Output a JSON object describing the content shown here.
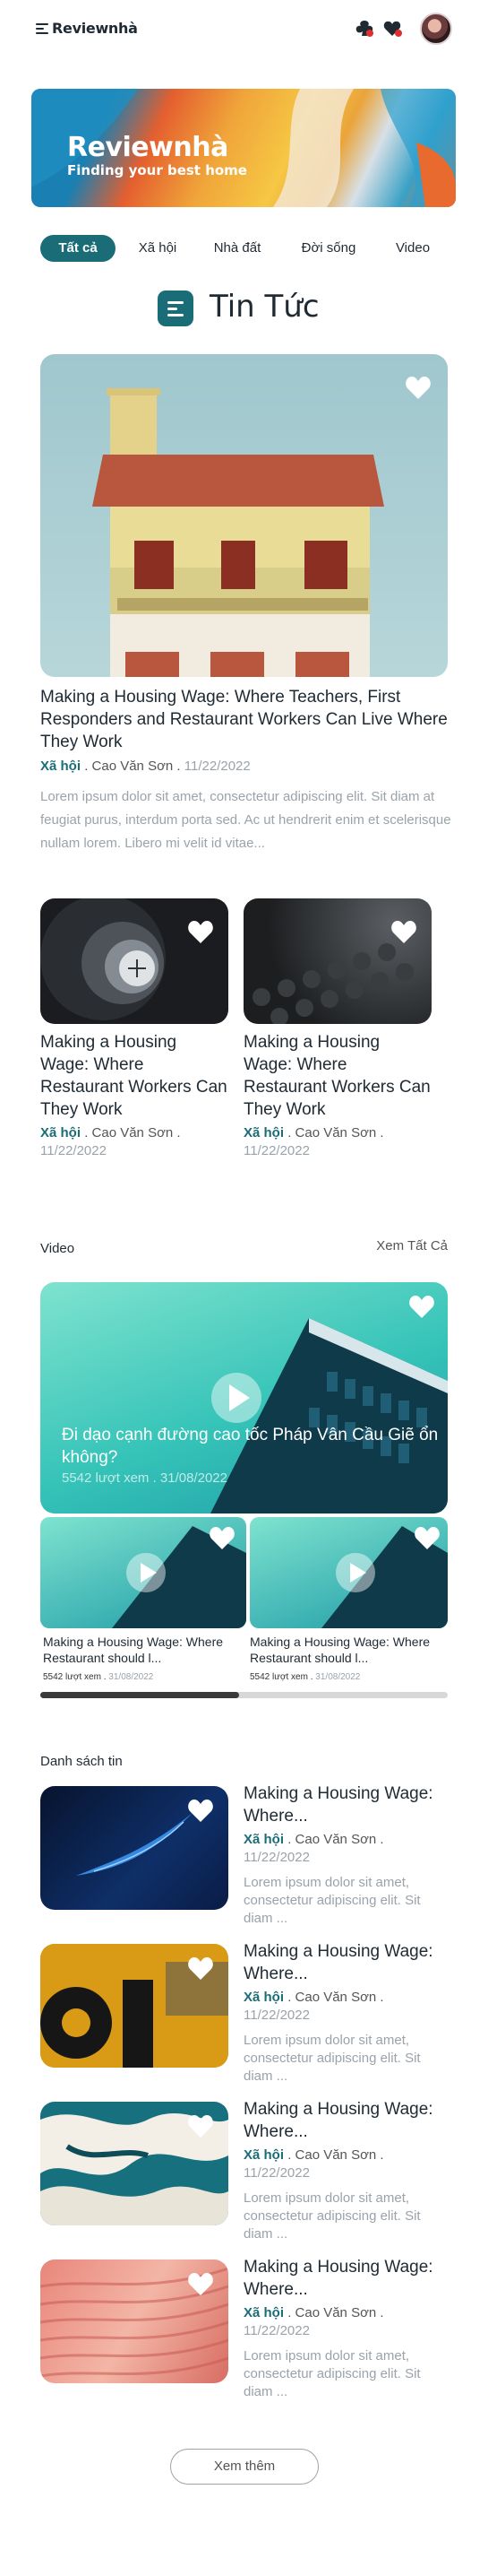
{
  "header": {
    "logo": "Reviewnhà"
  },
  "banner": {
    "title": "Reviewnhà",
    "subtitle": "Finding your best home"
  },
  "tabs": [
    "Tất cả",
    "Xã hội",
    "Nhà đất",
    "Đời sống",
    "Video"
  ],
  "section_title": "Tin Tức",
  "featured": {
    "title": "Making a Housing Wage: Where Teachers, First Responders and Restaurant Workers Can Live Where They Work",
    "category": "Xã hội",
    "author": ". Cao Văn Sơn .",
    "date": "11/22/2022",
    "desc": "Lorem ipsum dolor sit amet, consectetur adipiscing elit. Sit diam at feugiat purus, interdum porta sed. Ac ut hendrerit enim et scelerisque nullam lorem. Libero mi velit id vitae..."
  },
  "cards": [
    {
      "title": "Making a Housing Wage: Where Restaurant Workers Can They Work",
      "category": "Xã hội",
      "author": ". Cao Văn Sơn .",
      "date": "11/22/2022"
    },
    {
      "title": "Making a Housing Wage: Where Restaurant Workers Can They Work",
      "category": "Xã hội",
      "author": ". Cao Văn Sơn .",
      "date": "11/22/2022"
    }
  ],
  "video": {
    "heading": "Video",
    "see_all": "Xem Tất Cả",
    "main_title": "Đi dạo cạnh đường cao tốc Pháp Vân Cầu Giẽ ổn không?",
    "main_views": "5542 lượt xem . 31/08/2022",
    "items": [
      {
        "title": "Making a Housing Wage: Where Restaurant should l...",
        "views": "5542 lượt xem .",
        "date": "31/08/2022"
      },
      {
        "title": "Making a Housing Wage: Where Restaurant should l...",
        "views": "5542 lượt xem .",
        "date": "31/08/2022"
      }
    ]
  },
  "list": {
    "heading": "Danh sách tin",
    "items": [
      {
        "title": "Making a Housing Wage: Where...",
        "category": "Xã hội",
        "author": ". Cao Văn Sơn .",
        "date": "11/22/2022",
        "desc": "Lorem ipsum dolor sit amet, consectetur adipiscing elit. Sit diam ..."
      },
      {
        "title": "Making a Housing Wage: Where...",
        "category": "Xã hội",
        "author": ". Cao Văn Sơn .",
        "date": "11/22/2022",
        "desc": "Lorem ipsum dolor sit amet, consectetur adipiscing elit. Sit diam ..."
      },
      {
        "title": "Making a Housing Wage: Where...",
        "category": "Xã hội",
        "author": ". Cao Văn Sơn .",
        "date": "11/22/2022",
        "desc": "Lorem ipsum dolor sit amet, consectetur adipiscing elit. Sit diam ..."
      },
      {
        "title": "Making a Housing Wage: Where...",
        "category": "Xã hội",
        "author": ". Cao Văn Sơn .",
        "date": "11/22/2022",
        "desc": "Lorem ipsum dolor sit amet, consectetur adipiscing elit. Sit diam ..."
      }
    ]
  },
  "more_button": "Xem thêm",
  "colors": {
    "accent": "#1a6d76",
    "heart": "#e02d2d",
    "muted": "#9aa3aa"
  },
  "icons": [
    "menu-icon",
    "club-icon",
    "heart-icon",
    "play-icon",
    "list-icon"
  ]
}
